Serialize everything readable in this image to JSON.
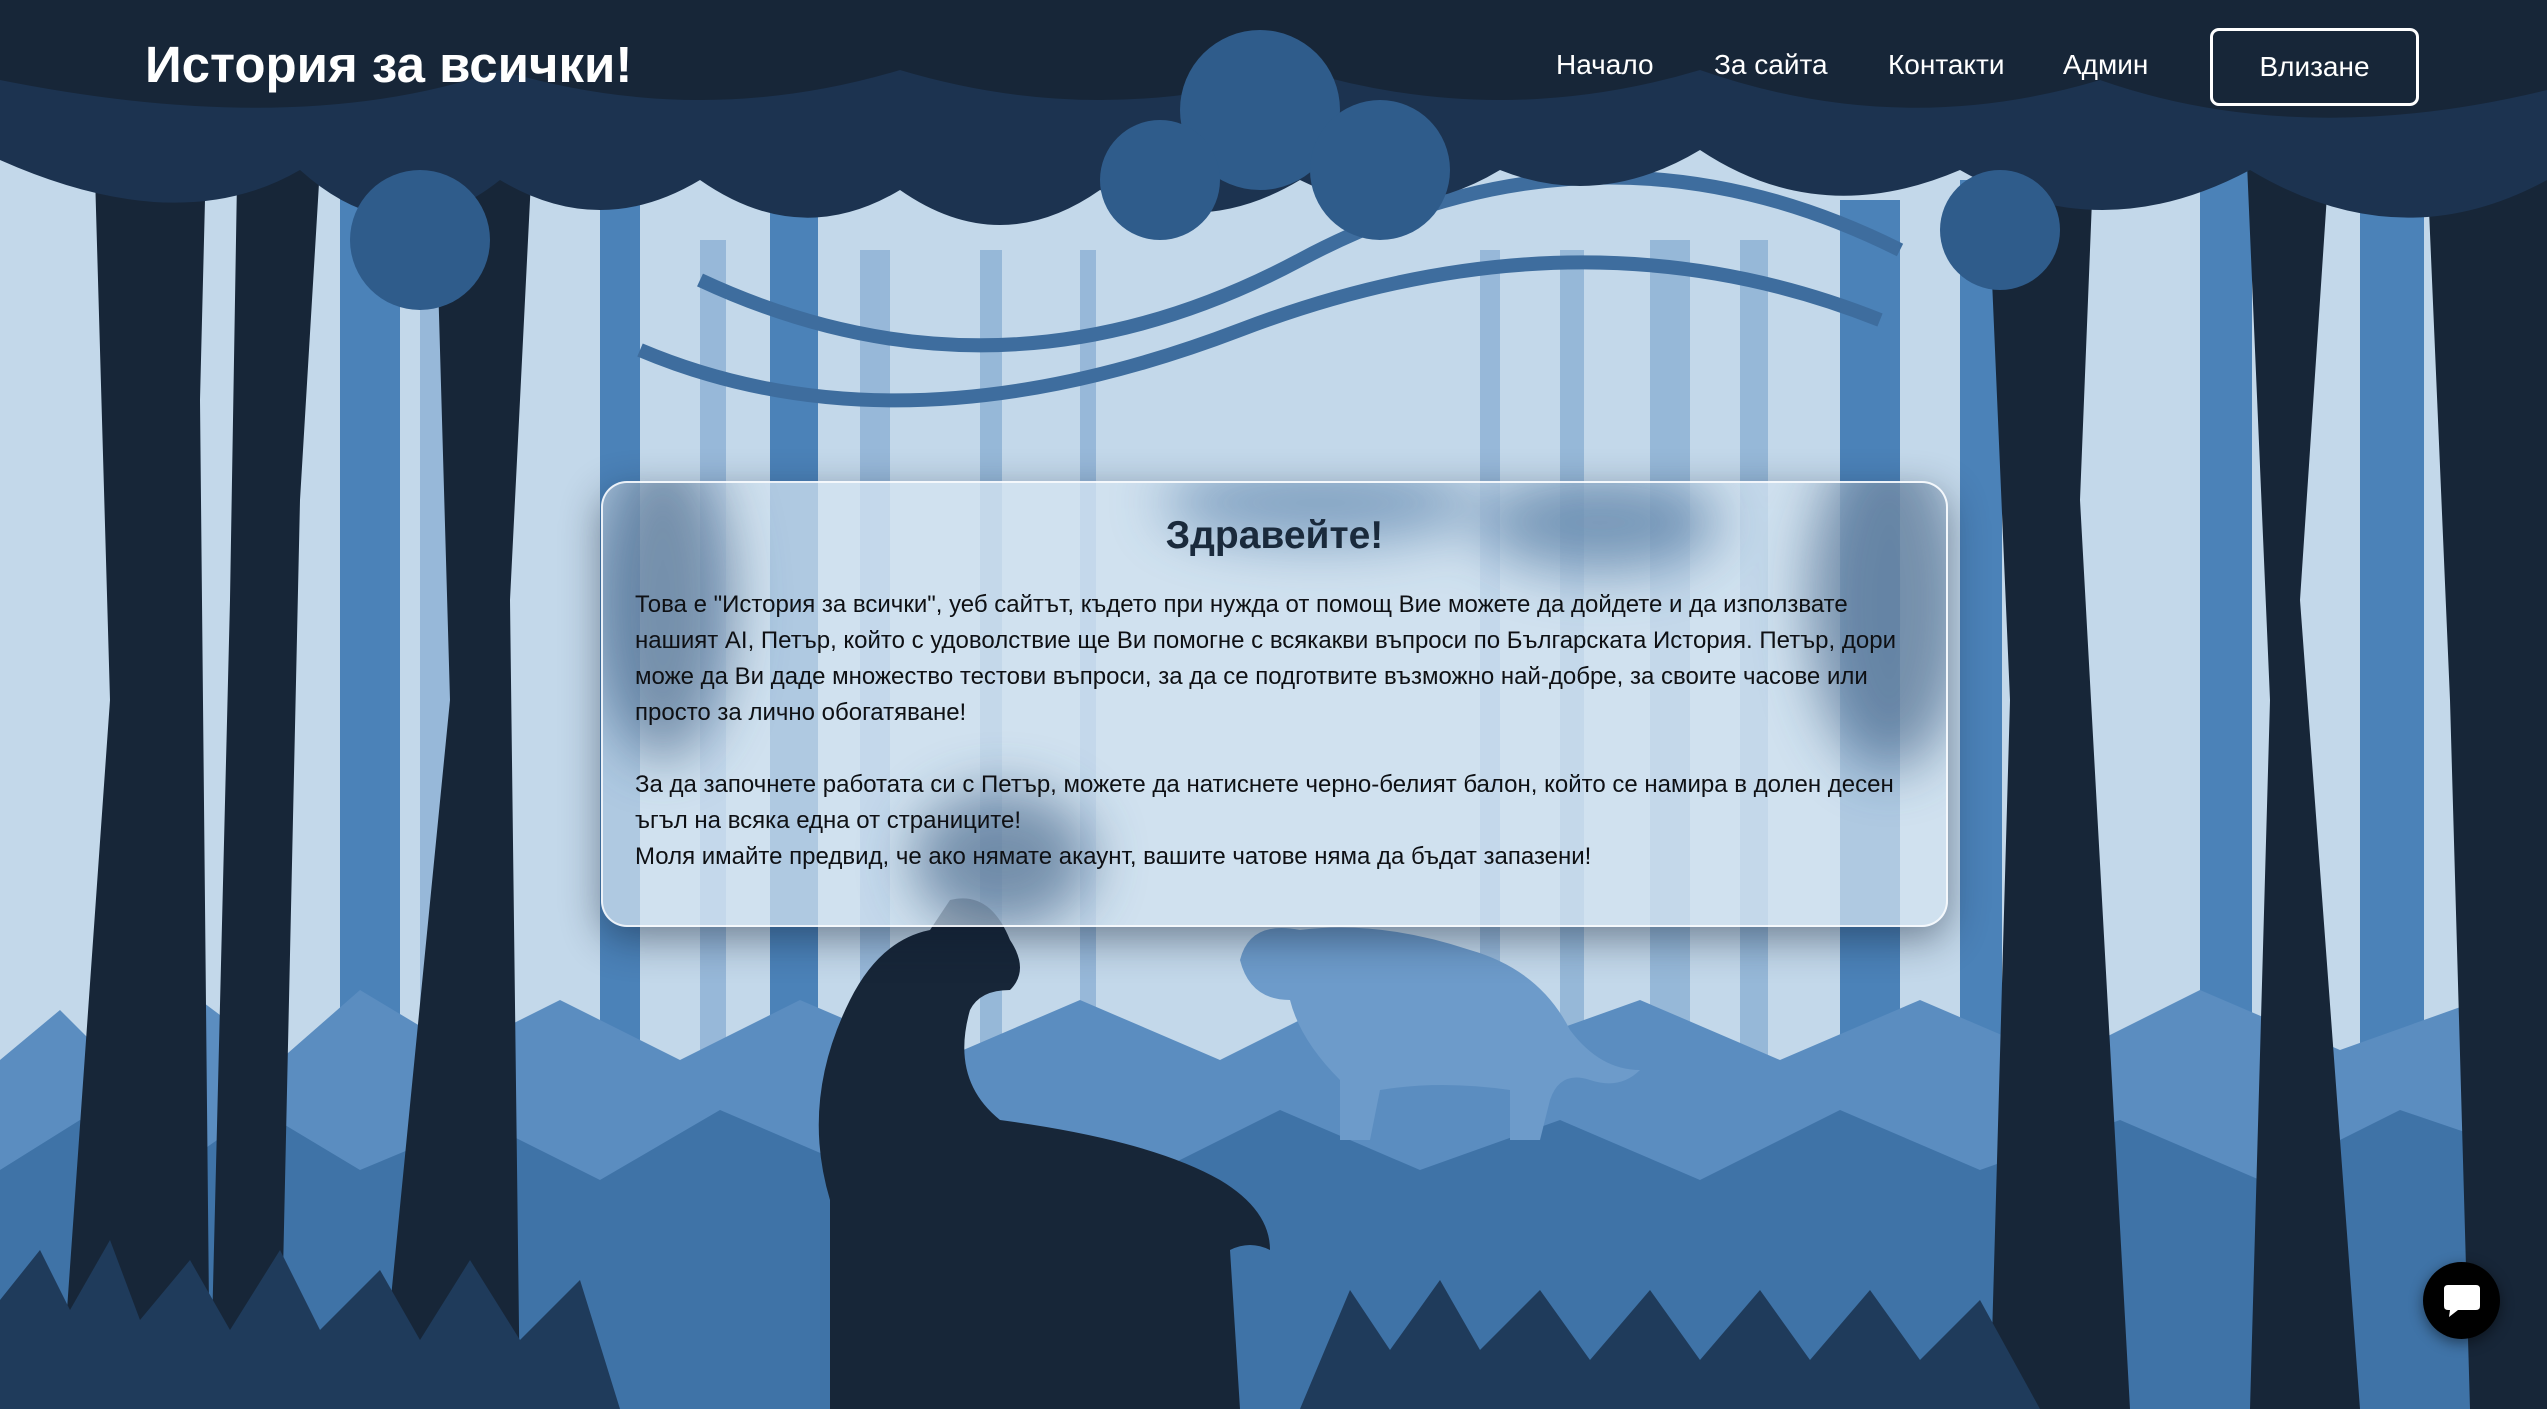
{
  "header": {
    "site_title": "История за всички!",
    "nav": {
      "home": "Начало",
      "about": "За сайта",
      "contacts": "Контакти",
      "admin": "Админ"
    },
    "login_label": "Влизане"
  },
  "welcome": {
    "title": "Здравейте!",
    "paragraph1": "Това е \"История за всички\", уеб сайтът, където при нужда от помощ Вие можете да дойдете и да използвате нашият AI, Петър, който с удоволствие ще Ви помогне с всякакви въпроси по Българската История. Петър, дори може да Ви даде множество тестови въпроси, за да се подготвите възможно най-добре, за своите часове или просто за лично обогатяване!",
    "paragraph2": "За да започнете работата си с Петър, можете да натиснете черно-белият балон, който се намира в долен десен ъгъл на всяка една от страниците!",
    "paragraph3": "Моля имайте предвид, че ако нямате акаунт, вашите чатове няма да бъдат запазени!"
  },
  "chat": {
    "icon": "chat-bubble-icon"
  },
  "colors": {
    "sky": "#c3d8ea",
    "dark_silhouette": "#172638",
    "mid_blue": "#2f5f8f",
    "light_blue": "#8fb3d6"
  }
}
